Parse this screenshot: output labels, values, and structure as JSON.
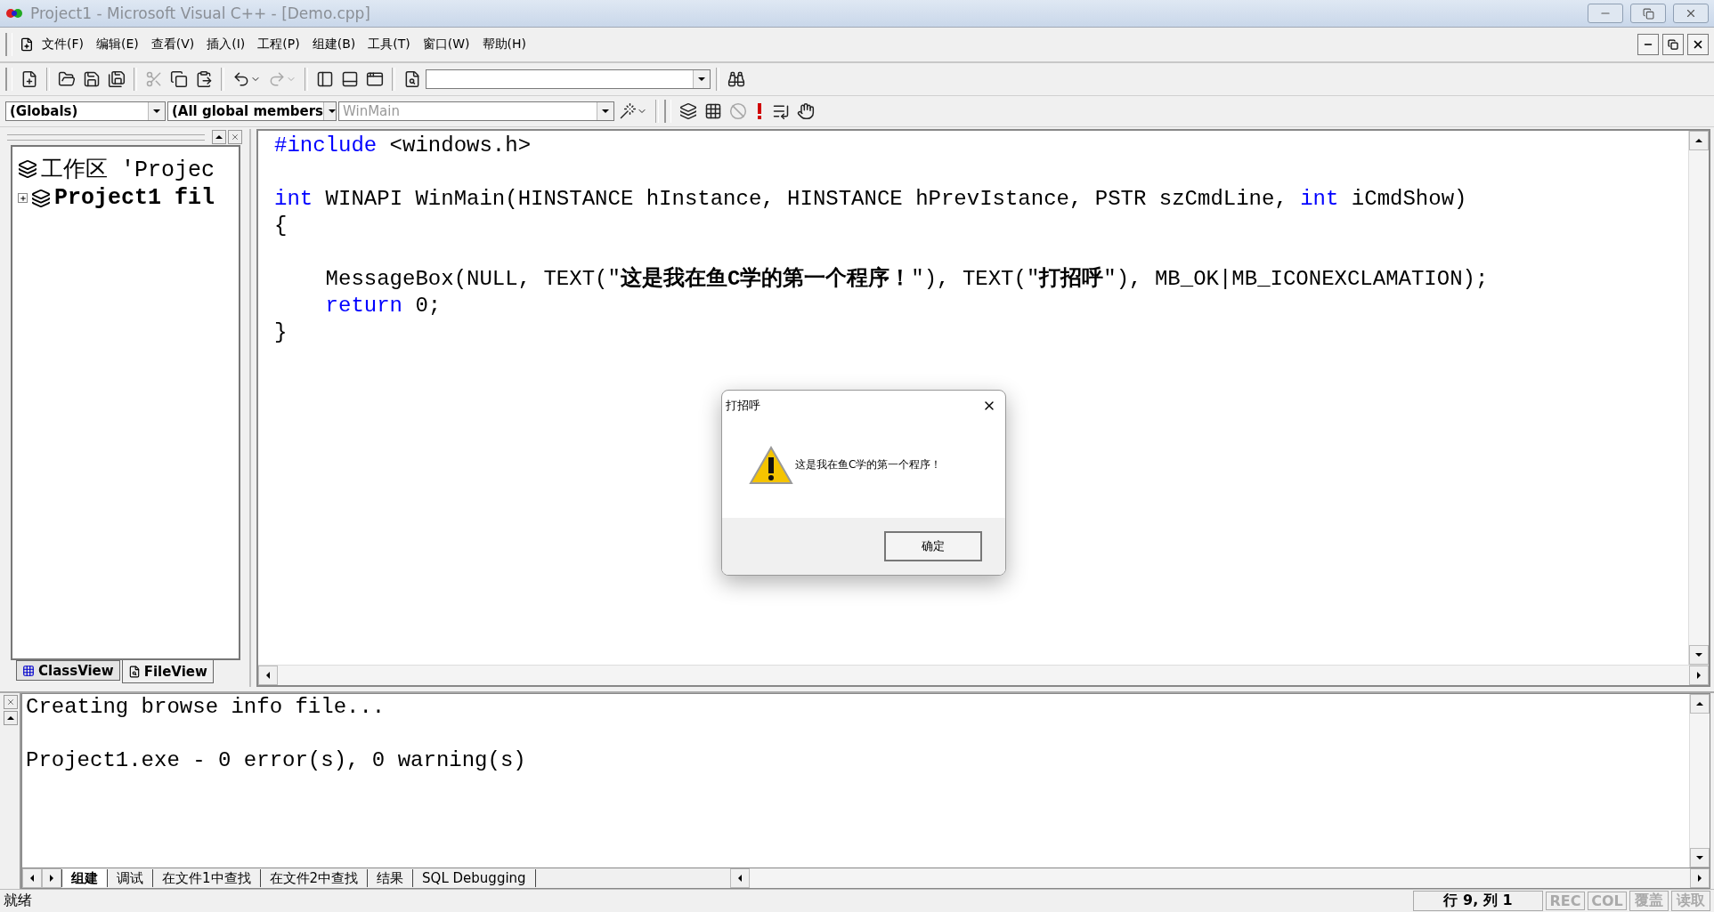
{
  "window": {
    "title": "Project1 - Microsoft Visual C++ - [Demo.cpp]"
  },
  "menu": {
    "items": [
      "文件(F)",
      "编辑(E)",
      "查看(V)",
      "插入(I)",
      "工程(P)",
      "组建(B)",
      "工具(T)",
      "窗口(W)",
      "帮助(H)"
    ]
  },
  "toolbar_1": {
    "buttons": [
      {
        "disabled": false
      },
      {
        "disabled": false
      },
      {
        "disabled": false
      },
      {
        "disabled": false
      },
      {
        "disabled": true
      },
      {
        "disabled": false
      },
      {
        "disabled": false
      },
      {
        "disabled": false
      },
      {
        "disabled": true
      },
      {
        "disabled": false
      },
      {
        "disabled": false
      },
      {
        "disabled": false
      },
      {
        "disabled": false
      },
      {
        "disabled": false
      }
    ]
  },
  "toolbar_2": {
    "combos": [
      {
        "value": "(Globals)",
        "disabled": false
      },
      {
        "value": "(All global members",
        "disabled": false
      },
      {
        "value": "WinMain",
        "disabled": true
      }
    ],
    "buttons": [
      {
        "disabled": false
      },
      {
        "disabled": false
      },
      {
        "disabled": false
      },
      {
        "disabled": true
      },
      {
        "disabled": false
      },
      {
        "disabled": false
      },
      {
        "disabled": false
      }
    ]
  },
  "workspace": {
    "tree": [
      {
        "label": "工作区 'Projec",
        "children": [
          {
            "label": "Project1 fil",
            "expanded": false
          }
        ]
      }
    ],
    "tabs": [
      {
        "label": "ClassView",
        "selected": false
      },
      {
        "label": "FileView",
        "selected": true
      }
    ]
  },
  "editor": {
    "lines": [
      {
        "kind": "code",
        "tokens": [
          {
            "text": "#include",
            "kind": "keyword"
          },
          {
            "text": " <windows.h>",
            "kind": "plain"
          }
        ]
      },
      {
        "kind": "blank"
      },
      {
        "kind": "code",
        "tokens": [
          {
            "text": "int",
            "kind": "keyword"
          },
          {
            "text": " WINAPI WinMain(HINSTANCE hInstance, HINSTANCE hPrevIstance, PSTR szCmdLine, ",
            "kind": "plain"
          },
          {
            "text": "int",
            "kind": "keyword"
          },
          {
            "text": " iCmdShow)",
            "kind": "plain"
          }
        ]
      },
      {
        "kind": "code",
        "tokens": [
          {
            "text": "{",
            "kind": "plain"
          }
        ]
      },
      {
        "kind": "blank"
      },
      {
        "kind": "code",
        "tokens": [
          {
            "text": "    MessageBox(NULL, TEXT(\"",
            "kind": "plain"
          },
          {
            "text": "这是我在鱼C学的第一个程序！",
            "kind": "strong"
          },
          {
            "text": "\"), TEXT(\"",
            "kind": "plain"
          },
          {
            "text": "打招呼",
            "kind": "strong"
          },
          {
            "text": "\"), MB_OK|MB_ICONEXCLAMATION);",
            "kind": "plain"
          }
        ]
      },
      {
        "kind": "code",
        "tokens": [
          {
            "text": "    return",
            "kind": "keyword"
          },
          {
            "text": " 0;",
            "kind": "plain"
          }
        ]
      },
      {
        "kind": "code",
        "tokens": [
          {
            "text": "}",
            "kind": "plain"
          }
        ]
      }
    ]
  },
  "output": {
    "lines": [
      {
        "kind": "text",
        "text": "Creating browse info file..."
      },
      {
        "kind": "blank"
      },
      {
        "kind": "text",
        "text": "Project1.exe - 0 error(s), 0 warning(s)"
      }
    ],
    "tabs": [
      {
        "label": "组建",
        "selected": true
      },
      {
        "label": "调试",
        "selected": false
      },
      {
        "label": "在文件1中查找",
        "selected": false
      },
      {
        "label": "在文件2中查找",
        "selected": false
      },
      {
        "label": "结果",
        "selected": false
      },
      {
        "label": "SQL Debugging",
        "selected": false
      }
    ]
  },
  "status_bar": {
    "message": "就绪",
    "position": "行 9, 列 1",
    "indicators": [
      {
        "text": "REC",
        "disabled": true
      },
      {
        "text": "COL",
        "disabled": true
      },
      {
        "text": "覆盖",
        "disabled": true
      },
      {
        "text": "读取",
        "disabled": true
      }
    ]
  },
  "dialog": {
    "title": "打招呼",
    "message": "这是我在鱼C学的第一个程序！",
    "button": "确定"
  }
}
